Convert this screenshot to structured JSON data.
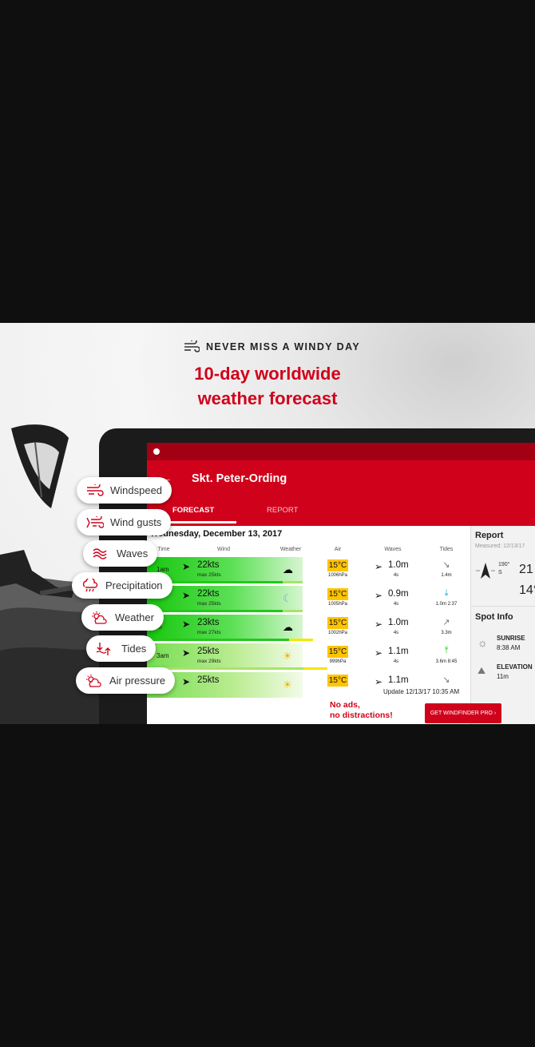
{
  "promo": {
    "tagline": "NEVER MISS A WINDY DAY",
    "headline_line1": "10-day worldwide",
    "headline_line2": "weather forecast"
  },
  "features": [
    "Windspeed",
    "Wind gusts",
    "Waves",
    "Precipitation",
    "Weather",
    "Tides",
    "Air pressure"
  ],
  "app": {
    "spot_name": "Skt. Peter-Ording",
    "tabs": [
      "FORECAST",
      "REPORT"
    ],
    "date": "Wednesday, December 13, 2017",
    "columns": [
      "Time",
      "Wind",
      "Weather",
      "Air",
      "Waves",
      "Tides"
    ],
    "rows": [
      {
        "time": "1am",
        "wind": "22kts",
        "gust": "max 25kts",
        "temp": "15°C",
        "pressure": "1006hPa",
        "wave": "1.0m",
        "period": "4s",
        "tide": "1.4m"
      },
      {
        "time": "",
        "wind": "22kts",
        "gust": "max 25kts",
        "temp": "15°C",
        "pressure": "1005hPa",
        "wave": "0.9m",
        "period": "4s",
        "tide": "1.0m 2:37"
      },
      {
        "time": "m",
        "wind": "23kts",
        "gust": "max 27kts",
        "temp": "15°C",
        "pressure": "1002hPa",
        "wave": "1.0m",
        "period": "4s",
        "tide": "3.3m"
      },
      {
        "time": "3am",
        "wind": "25kts",
        "gust": "max 29kts",
        "temp": "15°C",
        "pressure": "999hPa",
        "wave": "1.1m",
        "period": "4s",
        "tide": "3.6m 8:45"
      },
      {
        "time": "",
        "wind": "25kts",
        "gust": "",
        "temp": "15°C",
        "pressure": "",
        "wave": "1.1m",
        "period": "",
        "tide": ""
      }
    ],
    "update_text": "Update 12/13/17 10:35 AM",
    "report": {
      "title": "Report",
      "measured": "Measured: 12/13/17",
      "direction_deg": "190°",
      "direction_label": "S",
      "speed": "21",
      "temp": "14°"
    },
    "spot_info": {
      "title": "Spot Info",
      "sunrise_label": "SUNRISE",
      "sunrise_value": "8:38 AM",
      "elevation_label": "ELEVATION",
      "elevation_value": "11m"
    },
    "banner": {
      "noads_line1": "No ads,",
      "noads_line2": "no distractions!",
      "pro_button": "GET WINDFINDER PRO"
    }
  },
  "colors": {
    "brand_red": "#d0021b",
    "wind_green": "#16c70e",
    "temp_yellow": "#ffc400"
  }
}
